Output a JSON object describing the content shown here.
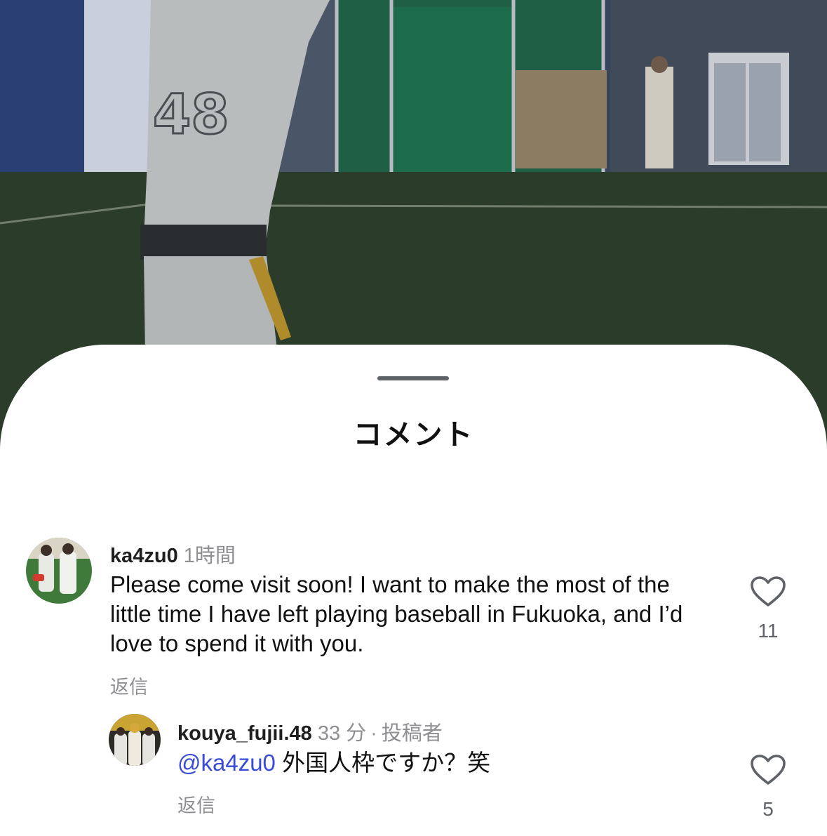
{
  "sheet": {
    "title": "コメント"
  },
  "video": {
    "jersey_number": "48"
  },
  "comments": [
    {
      "username": "ka4zu0",
      "time": "1時間",
      "text": "Please come visit soon! I want to make the most of the little time I have left playing baseball in Fukuoka, and I’d love to spend it with you.",
      "reply_label": "返信",
      "like_count": "11",
      "avatar_icon": "avatar-photo"
    }
  ],
  "replies": [
    {
      "username": "kouya_fujii.48",
      "time": "33 分",
      "separator": "·",
      "author_tag": "投稿者",
      "mention": "@ka4zu0",
      "text": "外国人枠ですか？笑",
      "reply_label": "返信",
      "like_count": "5",
      "avatar_icon": "avatar-photo"
    }
  ],
  "colors": {
    "mention": "#3a4bd8",
    "secondary_text": "#8e8e93",
    "sheet_background": "#ffffff"
  }
}
